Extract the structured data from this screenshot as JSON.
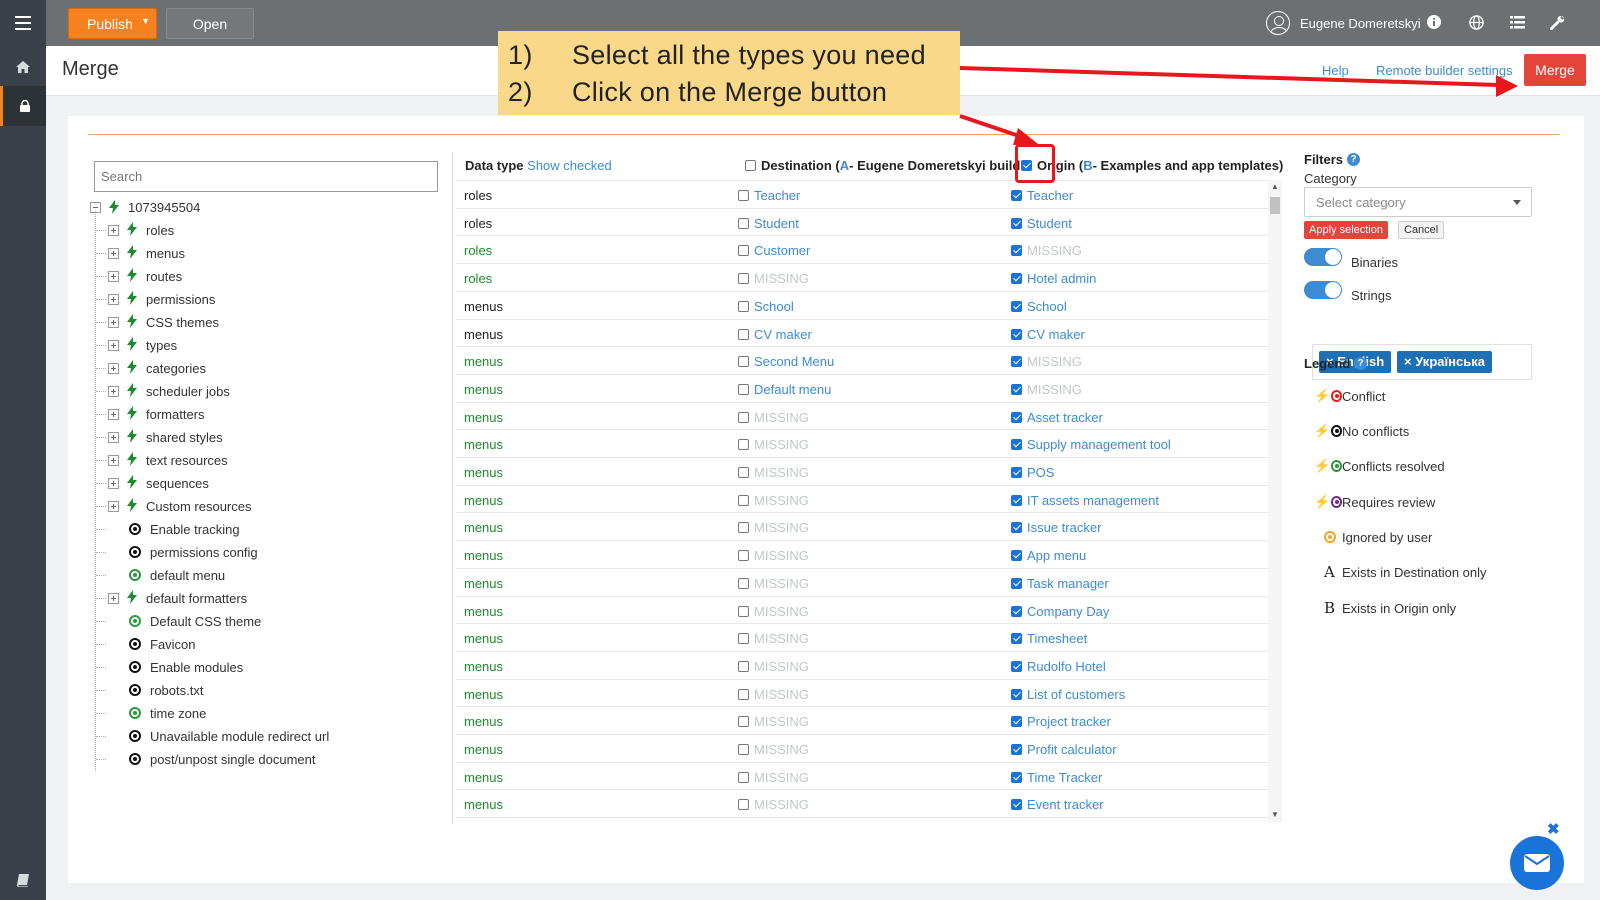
{
  "topbar": {
    "publish_label": "Publish",
    "open_label": "Open",
    "user_name": "Eugene Domeretskyi"
  },
  "header": {
    "title": "Merge",
    "help_label": "Help",
    "remote_settings_label": "Remote builder settings",
    "merge_label": "Merge"
  },
  "callout": {
    "lines": [
      {
        "num": "1)",
        "text": "Select all the types you need"
      },
      {
        "num": "2)",
        "text": "Click on the Merge button"
      }
    ]
  },
  "tree": {
    "search_placeholder": "Search",
    "root": "1073945504",
    "groups": [
      "roles",
      "menus",
      "routes",
      "permissions",
      "CSS themes",
      "types",
      "categories",
      "scheduler jobs",
      "formatters",
      "shared styles",
      "text resources",
      "sequences",
      "Custom resources"
    ],
    "leaves": [
      {
        "label": "Enable tracking",
        "icon": "dark"
      },
      {
        "label": "permissions config",
        "icon": "dark"
      },
      {
        "label": "default menu",
        "icon": "green"
      },
      {
        "label": "default formatters",
        "icon": "bolt-group"
      },
      {
        "label": "Default CSS theme",
        "icon": "green"
      },
      {
        "label": "Favicon",
        "icon": "dark"
      },
      {
        "label": "Enable modules",
        "icon": "dark"
      },
      {
        "label": "robots.txt",
        "icon": "dark"
      },
      {
        "label": "time zone",
        "icon": "green"
      },
      {
        "label": "Unavailable module redirect url",
        "icon": "dark"
      },
      {
        "label": "post/unpost single document",
        "icon": "dark"
      }
    ]
  },
  "table": {
    "col_type": "Data type",
    "show_checked": "Show checked",
    "dest_prefix": "Destination (",
    "dest_letter": "A",
    "dest_suffix": " - Eugene Domeretskyi build...",
    "origin_prefix": "Origin (",
    "origin_letter": "B",
    "origin_suffix": " - Examples and app templates)",
    "rows": [
      {
        "type": "roles",
        "green": false,
        "dest": "Teacher",
        "dest_missing": false,
        "orig": "Teacher",
        "orig_missing": false
      },
      {
        "type": "roles",
        "green": false,
        "dest": "Student",
        "dest_missing": false,
        "orig": "Student",
        "orig_missing": false
      },
      {
        "type": "roles",
        "green": true,
        "dest": "Customer",
        "dest_missing": false,
        "orig": "MISSING",
        "orig_missing": true
      },
      {
        "type": "roles",
        "green": true,
        "dest": "MISSING",
        "dest_missing": true,
        "orig": "Hotel admin",
        "orig_missing": false
      },
      {
        "type": "menus",
        "green": false,
        "dest": "School",
        "dest_missing": false,
        "orig": "School",
        "orig_missing": false
      },
      {
        "type": "menus",
        "green": false,
        "dest": "CV maker",
        "dest_missing": false,
        "orig": "CV maker",
        "orig_missing": false
      },
      {
        "type": "menus",
        "green": true,
        "dest": "Second Menu",
        "dest_missing": false,
        "orig": "MISSING",
        "orig_missing": true
      },
      {
        "type": "menus",
        "green": true,
        "dest": "Default menu",
        "dest_missing": false,
        "orig": "MISSING",
        "orig_missing": true
      },
      {
        "type": "menus",
        "green": true,
        "dest": "MISSING",
        "dest_missing": true,
        "orig": "Asset tracker",
        "orig_missing": false
      },
      {
        "type": "menus",
        "green": true,
        "dest": "MISSING",
        "dest_missing": true,
        "orig": "Supply management tool",
        "orig_missing": false
      },
      {
        "type": "menus",
        "green": true,
        "dest": "MISSING",
        "dest_missing": true,
        "orig": "POS",
        "orig_missing": false
      },
      {
        "type": "menus",
        "green": true,
        "dest": "MISSING",
        "dest_missing": true,
        "orig": "IT assets management",
        "orig_missing": false
      },
      {
        "type": "menus",
        "green": true,
        "dest": "MISSING",
        "dest_missing": true,
        "orig": "Issue tracker",
        "orig_missing": false
      },
      {
        "type": "menus",
        "green": true,
        "dest": "MISSING",
        "dest_missing": true,
        "orig": "App menu",
        "orig_missing": false
      },
      {
        "type": "menus",
        "green": true,
        "dest": "MISSING",
        "dest_missing": true,
        "orig": "Task manager",
        "orig_missing": false
      },
      {
        "type": "menus",
        "green": true,
        "dest": "MISSING",
        "dest_missing": true,
        "orig": "Company Day",
        "orig_missing": false
      },
      {
        "type": "menus",
        "green": true,
        "dest": "MISSING",
        "dest_missing": true,
        "orig": "Timesheet",
        "orig_missing": false
      },
      {
        "type": "menus",
        "green": true,
        "dest": "MISSING",
        "dest_missing": true,
        "orig": "Rudolfo Hotel",
        "orig_missing": false
      },
      {
        "type": "menus",
        "green": true,
        "dest": "MISSING",
        "dest_missing": true,
        "orig": "List of customers",
        "orig_missing": false
      },
      {
        "type": "menus",
        "green": true,
        "dest": "MISSING",
        "dest_missing": true,
        "orig": "Project tracker",
        "orig_missing": false
      },
      {
        "type": "menus",
        "green": true,
        "dest": "MISSING",
        "dest_missing": true,
        "orig": "Profit calculator",
        "orig_missing": false
      },
      {
        "type": "menus",
        "green": true,
        "dest": "MISSING",
        "dest_missing": true,
        "orig": "Time Tracker",
        "orig_missing": false
      },
      {
        "type": "menus",
        "green": true,
        "dest": "MISSING",
        "dest_missing": true,
        "orig": "Event tracker",
        "orig_missing": false
      }
    ]
  },
  "filters": {
    "title": "Filters",
    "category_label": "Category",
    "category_placeholder": "Select category",
    "apply_label": "Apply selection",
    "cancel_label": "Cancel",
    "binaries_label": "Binaries",
    "strings_label": "Strings",
    "languages": [
      "English",
      "Українська"
    ]
  },
  "legend": {
    "title": "Legend",
    "items": [
      {
        "label": "Conflict",
        "color": "#e3211c"
      },
      {
        "label": "No conflicts",
        "color": "#111111"
      },
      {
        "label": "Conflicts resolved",
        "color": "#2a9a3a"
      },
      {
        "label": "Requires review",
        "color": "#7a2a8a"
      },
      {
        "label": "Ignored by user",
        "color": "#f5a623"
      },
      {
        "label": "Exists in Destination only",
        "letter": "A"
      },
      {
        "label": "Exists in Origin only",
        "letter": "B"
      }
    ]
  },
  "colors": {
    "accent": "#f5821f",
    "merge": "#e3453b",
    "link": "#3d8bd2",
    "annotation_red": "#e8171e",
    "callout_bg": "#fad88a"
  },
  "icons": [
    "menu-icon",
    "home-icon",
    "lock-icon",
    "book-icon",
    "info-icon",
    "globe-icon",
    "list-icon",
    "wrench-icon",
    "user-icon",
    "chat-icon"
  ]
}
